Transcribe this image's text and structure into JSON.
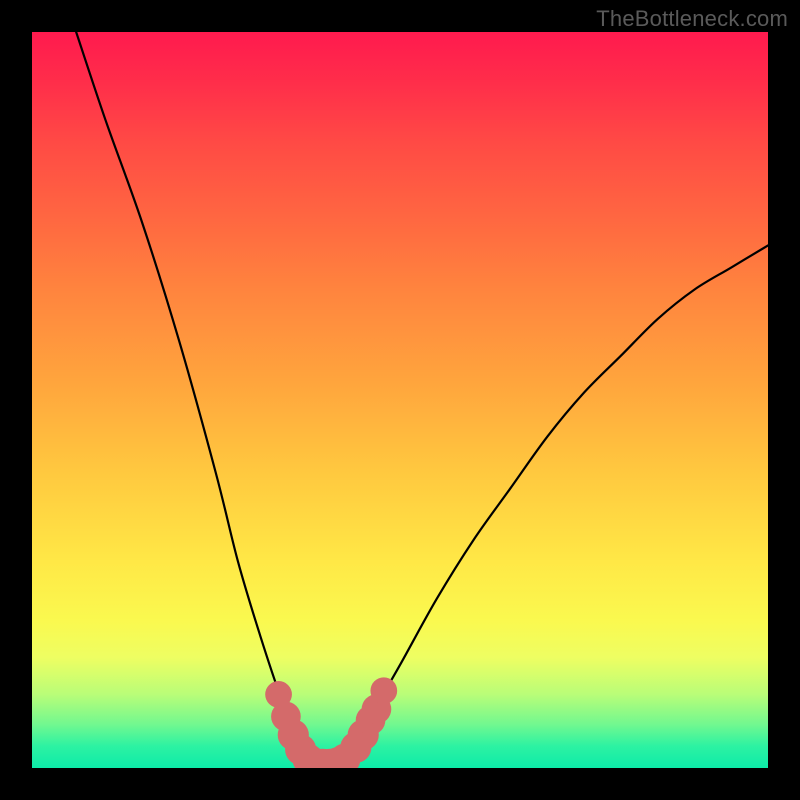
{
  "watermark": {
    "text": "TheBottleneck.com"
  },
  "chart_data": {
    "type": "line",
    "title": "",
    "xlabel": "",
    "ylabel": "",
    "xlim": [
      0,
      100
    ],
    "ylim": [
      0,
      100
    ],
    "series": [
      {
        "name": "bottleneck-curve",
        "x": [
          6,
          10,
          15,
          20,
          25,
          28,
          31,
          34,
          36,
          37,
          38,
          39,
          40,
          41,
          42,
          44,
          46,
          50,
          55,
          60,
          65,
          70,
          75,
          80,
          85,
          90,
          95,
          100
        ],
        "y": [
          100,
          88,
          74,
          58,
          40,
          28,
          18,
          9,
          4,
          2,
          1,
          0.5,
          0.5,
          0.5,
          1,
          3,
          7,
          14,
          23,
          31,
          38,
          45,
          51,
          56,
          61,
          65,
          68,
          71
        ]
      }
    ],
    "markers": {
      "name": "highlight-points",
      "color": "#d46a6a",
      "points": [
        {
          "x": 33.5,
          "y": 10,
          "r": 1.0
        },
        {
          "x": 34.5,
          "y": 7,
          "r": 1.2
        },
        {
          "x": 35.5,
          "y": 4.5,
          "r": 1.3
        },
        {
          "x": 36.5,
          "y": 2.5,
          "r": 1.3
        },
        {
          "x": 37.5,
          "y": 1.2,
          "r": 1.3
        },
        {
          "x": 38.5,
          "y": 0.6,
          "r": 1.3
        },
        {
          "x": 39.5,
          "y": 0.5,
          "r": 1.3
        },
        {
          "x": 40.5,
          "y": 0.5,
          "r": 1.3
        },
        {
          "x": 41.5,
          "y": 0.7,
          "r": 1.3
        },
        {
          "x": 42.5,
          "y": 1.2,
          "r": 1.3
        },
        {
          "x": 44.0,
          "y": 2.8,
          "r": 1.3
        },
        {
          "x": 45.0,
          "y": 4.5,
          "r": 1.3
        },
        {
          "x": 46.0,
          "y": 6.5,
          "r": 1.2
        },
        {
          "x": 46.8,
          "y": 8.0,
          "r": 1.2
        },
        {
          "x": 47.8,
          "y": 10.5,
          "r": 1.0
        }
      ]
    }
  }
}
